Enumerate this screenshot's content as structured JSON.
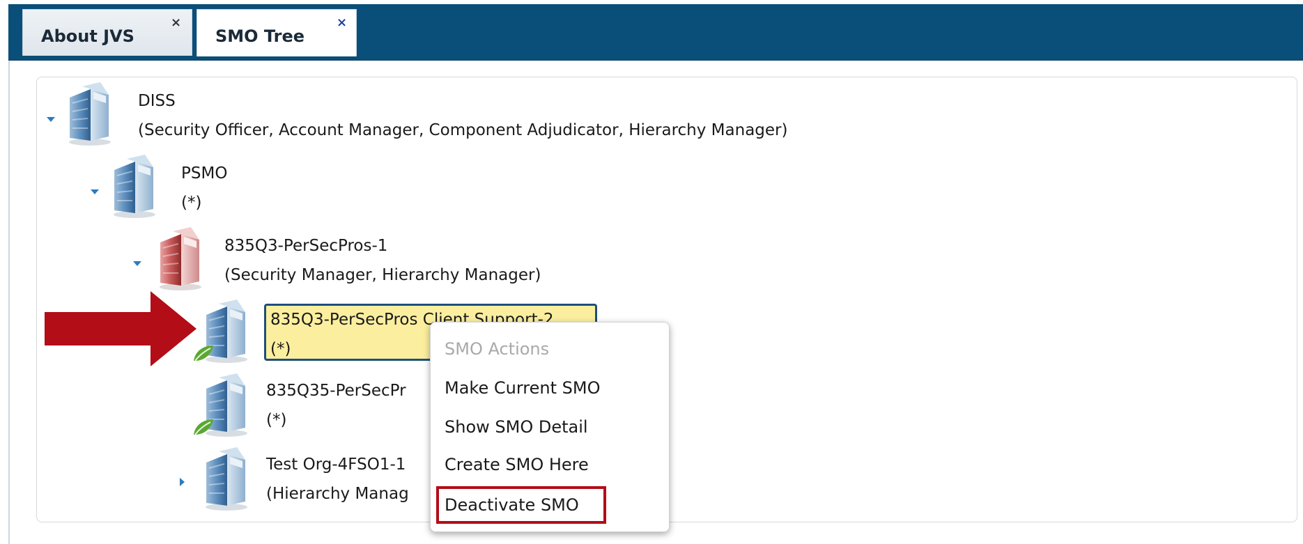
{
  "tabs": [
    {
      "label": "About JVS",
      "close": "×"
    },
    {
      "label": "SMO Tree",
      "close": "×"
    }
  ],
  "tree": {
    "nodes": [
      {
        "name": "DISS",
        "roles": "(Security Officer, Account Manager, Component Adjudicator, Hierarchy Manager)",
        "icon": "building-blue-icon"
      },
      {
        "name": "PSMO",
        "roles": "(*)",
        "icon": "building-blue-icon"
      },
      {
        "name": "835Q3-PerSecPros-1",
        "roles": "(Security Manager, Hierarchy Manager)",
        "icon": "building-red-icon"
      },
      {
        "name": "835Q3-PerSecPros Client Support-2",
        "roles": "(*)",
        "icon": "building-blue-leaf-icon"
      },
      {
        "name": "835Q35-PerSecPr",
        "roles": "(*)",
        "icon": "building-blue-leaf-icon"
      },
      {
        "name": "Test Org-4FSO1-1",
        "roles": "(Hierarchy Manag",
        "icon": "building-blue-icon"
      }
    ]
  },
  "context_menu": {
    "header": "SMO Actions",
    "items": [
      "Make Current SMO",
      "Show SMO Detail",
      "Create SMO Here",
      "Deactivate SMO"
    ]
  },
  "colors": {
    "tabbar": "#0a4f7a",
    "selection_fill": "#fbef9f",
    "arrow": "#b30d17",
    "toggle": "#2a7bbf"
  }
}
